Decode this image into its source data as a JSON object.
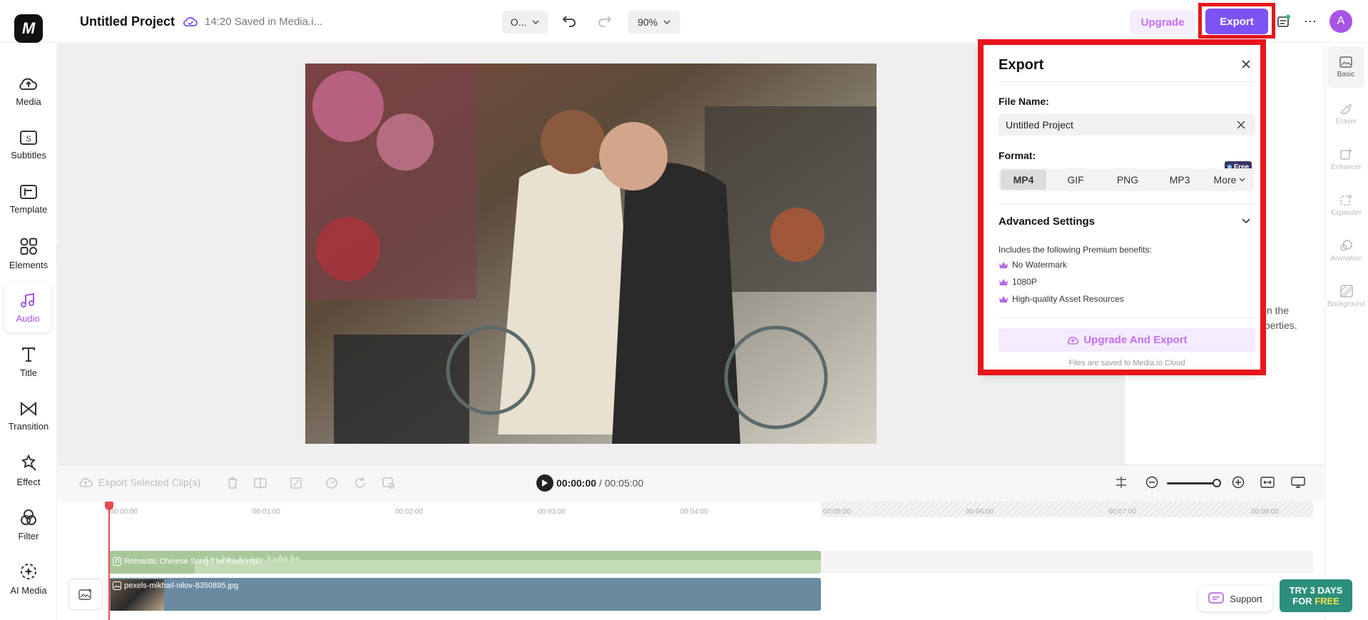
{
  "app": {
    "logo_text": "M",
    "project_title": "Untitled Project",
    "save_status": "14:20 Saved in Media.i..."
  },
  "toolbar": {
    "ratio_value": "O...",
    "zoom_value": "90%",
    "upgrade_label": "Upgrade",
    "export_label": "Export",
    "avatar_initial": "A"
  },
  "sidebar": {
    "items": [
      {
        "label": "Media",
        "icon": "cloud-upload-icon"
      },
      {
        "label": "Subtitles",
        "icon": "subtitles-icon"
      },
      {
        "label": "Template",
        "icon": "template-icon"
      },
      {
        "label": "Elements",
        "icon": "elements-icon"
      },
      {
        "label": "Audio",
        "icon": "music-note-icon",
        "active": true
      },
      {
        "label": "Title",
        "icon": "text-icon"
      },
      {
        "label": "Transition",
        "icon": "transition-icon"
      },
      {
        "label": "Effect",
        "icon": "effect-icon"
      },
      {
        "label": "Filter",
        "icon": "filter-icon"
      },
      {
        "label": "AI Media",
        "icon": "ai-media-icon"
      }
    ]
  },
  "right_tools": [
    {
      "label": "Basic",
      "active": true
    },
    {
      "label": "Eraser"
    },
    {
      "label": "Enhancer"
    },
    {
      "label": "Expander"
    },
    {
      "label": "Animation"
    },
    {
      "label": "Background"
    }
  ],
  "props_hint": {
    "line1": "t in the",
    "line2": "operties."
  },
  "export_dialog": {
    "title": "Export",
    "file_name_label": "File Name:",
    "file_name_value": "Untitled Project",
    "format_label": "Format:",
    "formats": [
      "MP4",
      "GIF",
      "PNG",
      "MP3",
      "More"
    ],
    "selected_format": "MP4",
    "free_badge": "Free",
    "advanced_settings": "Advanced Settings",
    "benefits_intro": "Includes the following Premium benefits:",
    "benefits": [
      "No Watermark",
      "1080P",
      "High-quality Asset Resources"
    ],
    "upgrade_export_label": "Upgrade And Export",
    "cloud_note": "Files are saved to Media.io Cloud"
  },
  "timeline": {
    "export_selected": "Export Selected Clip(s)",
    "current_time": "00:00:00",
    "total_time": "/ 00:05:00",
    "ticks": [
      "00:00:00",
      "00:01:00",
      "00:02:00",
      "00:03:00",
      "00:04:00",
      "00:05:00",
      "00:06:00",
      "00:07:00",
      "00:08:00"
    ],
    "audio_clip": "Romantic Chinese Song  The River.mp3",
    "video_clip": "pexels-mikhail-nilov-8350895.jpg"
  },
  "support_label": "Support",
  "trial": {
    "line1": "TRY 3 DAYS",
    "line2_a": "FOR ",
    "line2_b": "FREE"
  },
  "colors": {
    "accent": "#7c52f5",
    "upgrade": "#c76ef1",
    "highlight": "#e8151b",
    "audio": "#a8c79a",
    "video": "#6a8aa0"
  }
}
